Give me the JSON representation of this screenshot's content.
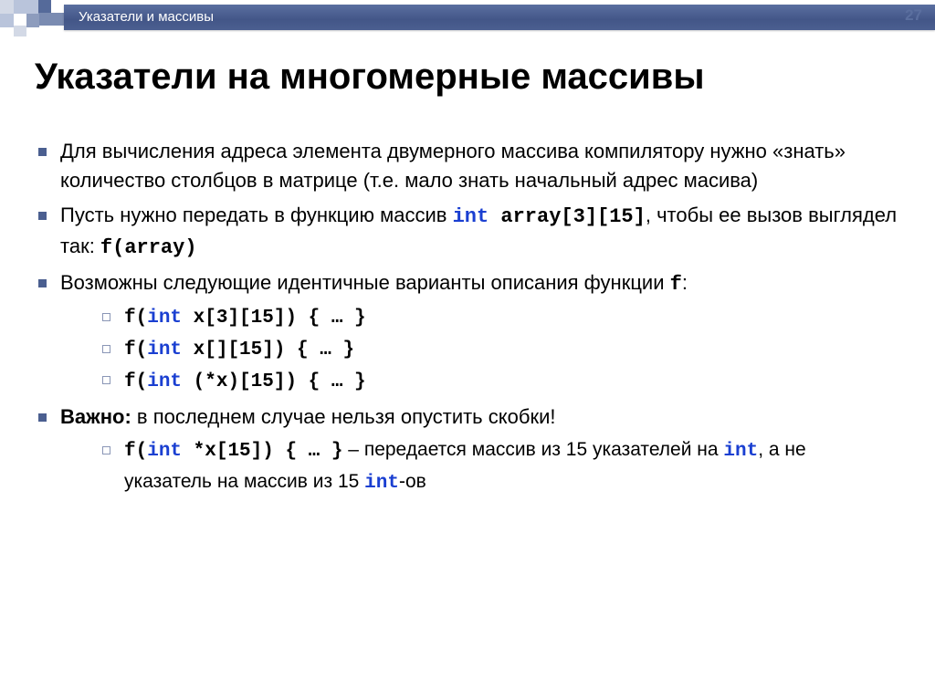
{
  "page_number": "27",
  "header": "Указатели и массивы",
  "title": "Указатели на многомерные массивы",
  "b1": {
    "p1": "Для вычисления адреса элемента двумерного массива компилятору нужно «знать» количество столбцов в матрице (т.е. мало знать начальный адрес масива)",
    "p2a": "Пусть нужно передать в функцию массив ",
    "p2_code1_kw": "int",
    "p2_code1_rest": " array[3][15]",
    "p2b": ", чтобы ее вызов выглядел так: ",
    "p2_code2": "f(array)",
    "p3a": "Возможны следующие идентичные  варианты описания функции ",
    "p3_code": "f",
    "p3b": ":",
    "sub": {
      "s1_pre": "f(",
      "s1_kw": "int",
      "s1_post": " x[3][15]) { … }",
      "s2_pre": "f(",
      "s2_kw": "int",
      "s2_post": " x[][15]) { … }",
      "s3_pre": "f(",
      "s3_kw": "int",
      "s3_post": " (*x)[15]) { … }"
    },
    "p4_strong": "Важно:",
    "p4_rest": " в последнем случае нельзя опустить скобки!",
    "sub2": {
      "s1_pre": "f(",
      "s1_kw": "int",
      "s1_mid": " *x[15]) { … }",
      "s1_after": " – передается массив из 15 указателей на ",
      "s1_kw2": "int",
      "s1_mid2": ", а не указатель на массив из 15 ",
      "s1_kw3": "int",
      "s1_tail": "-ов"
    }
  }
}
